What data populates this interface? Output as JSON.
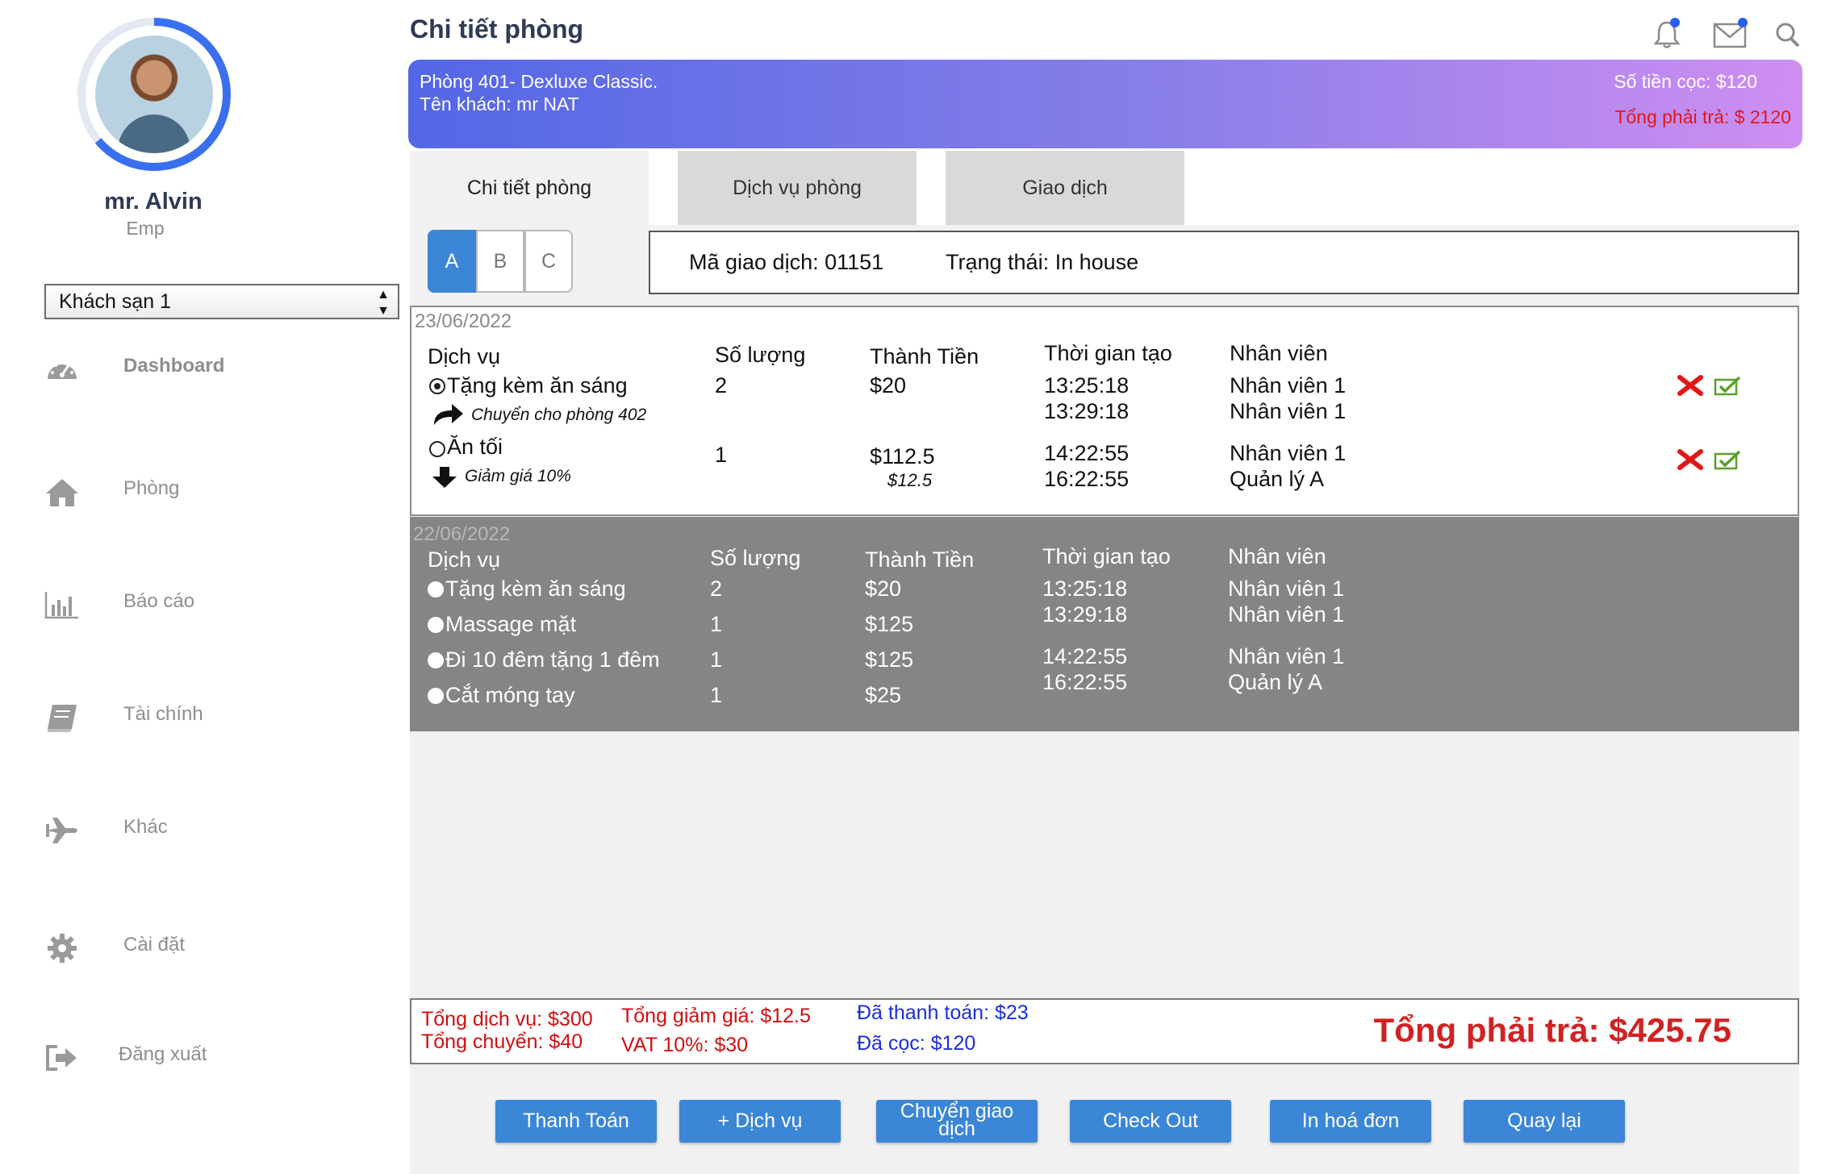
{
  "sidebar": {
    "user_name": "mr. Alvin",
    "user_role": "Emp",
    "hotel_select": "Khách sạn 1",
    "items": [
      {
        "label": "Dashboard",
        "icon": "dashboard-icon"
      },
      {
        "label": "Phòng",
        "icon": "home-icon"
      },
      {
        "label": "Báo cáo",
        "icon": "bar-chart-icon"
      },
      {
        "label": "Tài chính",
        "icon": "book-icon"
      },
      {
        "label": "Khác",
        "icon": "airplane-icon"
      },
      {
        "label": "Cài đặt",
        "icon": "gear-icon"
      },
      {
        "label": "Đăng xuất",
        "icon": "logout-icon"
      }
    ]
  },
  "header": {
    "title": "Chi tiết phòng",
    "icons": [
      "bell-icon",
      "mail-icon",
      "search-icon"
    ],
    "accent": "#3a6ff0"
  },
  "banner": {
    "room": "Phòng 401- Dexluxe Classic.",
    "guest": "Tên khách: mr NAT",
    "deposit": "Số tiền cọc: $120",
    "total": "Tổng phải trả: $ 2120"
  },
  "tabs": [
    "Chi tiết phòng",
    "Dịch vụ phòng",
    "Giao dịch"
  ],
  "segments": [
    "A",
    "B",
    "C"
  ],
  "transaction": {
    "code": "Mã giao dịch: 01151",
    "status": "Trạng thái: In house"
  },
  "columns": [
    "Dịch vụ",
    "Số lượng",
    "Thành Tiền",
    "Thời gian tạo",
    "Nhân viên"
  ],
  "day1": {
    "date": "23/06/2022",
    "rows": [
      {
        "service": "Tặng kèm ăn sáng",
        "qty": "2",
        "amount": "$20",
        "time1": "13:25:18",
        "time2": "13:29:18",
        "staff1": "Nhân viên 1",
        "staff2": "Nhân viên 1",
        "note": "Chuyển cho phòng 402"
      },
      {
        "service": "Ăn tối",
        "qty": "1",
        "amount": "$112.5",
        "amount_sub": "$12.5",
        "time1": "14:22:55",
        "time2": "16:22:55",
        "staff1": "Nhân viên 1",
        "staff2": "Quản lý A",
        "note": "Giảm giá 10%"
      }
    ]
  },
  "day2": {
    "date": "22/06/2022",
    "rows": [
      {
        "service": "Tặng kèm ăn sáng",
        "qty": "2",
        "amount": "$20"
      },
      {
        "service": "Massage mặt",
        "qty": "1",
        "amount": "$125"
      },
      {
        "service": "Đi 10 đêm tặng 1 đêm",
        "qty": "1",
        "amount": "$125"
      },
      {
        "service": "Cắt móng tay",
        "qty": "1",
        "amount": "$25"
      }
    ],
    "times": [
      "13:25:18",
      "13:29:18",
      "14:22:55",
      "16:22:55"
    ],
    "staff": [
      "Nhân viên 1",
      "Nhân viên 1",
      "Nhân viên 1",
      "Quản lý A"
    ]
  },
  "summary": {
    "services_total": "Tổng dịch vụ: $300",
    "transfer_total": "Tổng chuyển: $40",
    "discount_total": "Tổng giảm giá: $12.5",
    "vat": "VAT 10%: $30",
    "paid": "Đã thanh toán: $23",
    "deposited": "Đã cọc: $120",
    "grand_total": "Tổng phải trả: $425.75"
  },
  "buttons": {
    "pay": "Thanh Toán",
    "add_service": "+ Dịch vụ",
    "transfer_line1": "Chuyển giao",
    "transfer_line2": "dịch",
    "checkout": "Check Out",
    "print": "In hoá đơn",
    "back": "Quay lại"
  }
}
